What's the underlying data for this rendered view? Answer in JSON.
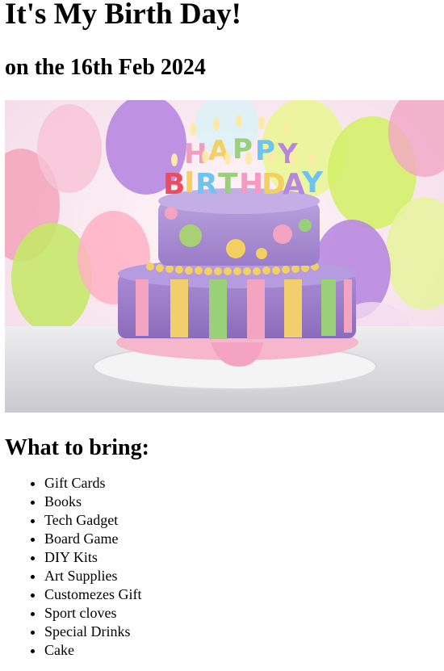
{
  "header": {
    "title": "It's My Birth Day!",
    "date_line": "on the 16th Feb 2024"
  },
  "photo": {
    "alt": "Birthday cake with HAPPY BIRTHDAY candles"
  },
  "bring": {
    "heading": "What to bring:",
    "items": [
      "Gift Cards",
      "Books",
      "Tech Gadget",
      "Board Game",
      "DIY Kits",
      "Art Supplies",
      "Customezes Gift",
      "Sport cloves",
      "Special Drinks",
      "Cake"
    ]
  }
}
